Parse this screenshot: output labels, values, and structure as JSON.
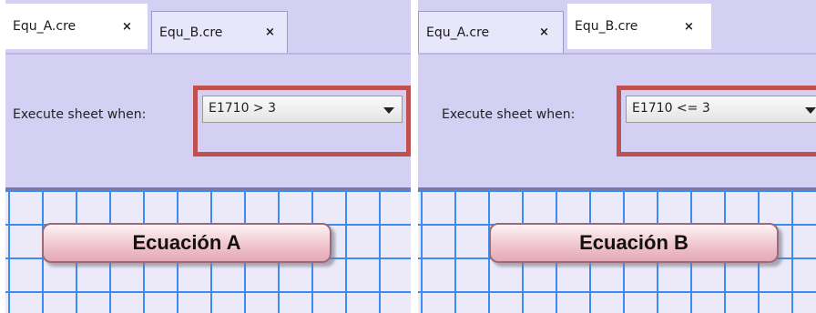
{
  "panels": [
    {
      "tabs": [
        {
          "label": "Equ_A.cre",
          "close": "×",
          "active": true
        },
        {
          "label": "Equ_B.cre",
          "close": "×",
          "active": false
        }
      ],
      "execute_label": "Execute sheet when:",
      "condition": "E1710 > 3",
      "equation_label": "Ecuación A"
    },
    {
      "tabs": [
        {
          "label": "Equ_A.cre",
          "close": "×",
          "active": false
        },
        {
          "label": "Equ_B.cre",
          "close": "×",
          "active": true
        }
      ],
      "execute_label": "Execute sheet when:",
      "condition": "E1710 <= 3",
      "equation_label": "Ecuación B"
    }
  ],
  "colors": {
    "panel_bg": "#d4d0f3",
    "grid_line": "#3f8cf0",
    "highlight": "#c0504d",
    "equation_box": "#efc2cc"
  },
  "icons": {
    "tab_close": "close-icon",
    "combo_arrow": "chevron-down-icon"
  }
}
